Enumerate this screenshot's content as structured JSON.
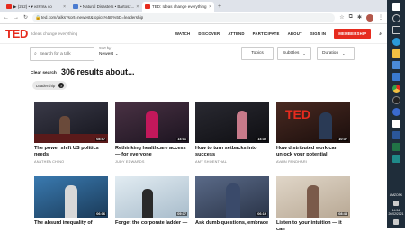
{
  "browser": {
    "tabs": [
      {
        "label": "▶ (262) • ♥ ᴋᴇᴘᴛʀᴀ ᴄᴏ",
        "color": "#e62b1e",
        "active": false
      },
      {
        "label": "• Natural Disasters • Bartosz...",
        "color": "#4a7bd0",
        "active": false
      },
      {
        "label": "TED: Ideas change everything",
        "color": "#e62b1e",
        "active": true
      }
    ],
    "url": "ted.com/talks?sort=newest&topics%5B%5D=leadership"
  },
  "header": {
    "logo": "TED",
    "tagline": "Ideas change everything",
    "nav": [
      "WATCH",
      "DISCOVER",
      "ATTEND",
      "PARTICIPATE",
      "ABOUT",
      "SIGN IN"
    ],
    "membership": "MEMBERSHIP"
  },
  "filters": {
    "search_placeholder": "Search for a talk",
    "sort_label": "Sort by",
    "sort_value": "Newest",
    "topics": "Topics",
    "subtitles": "Subtitles",
    "duration": "Duration"
  },
  "results": {
    "clear": "Clear search",
    "count_text": "306 results about...",
    "chip": "Leadership"
  },
  "talks": [
    {
      "title": "The power shift US politics needs",
      "speaker": "ANATHEA CHINO",
      "duration": "08:57",
      "bg": "#2a2a35"
    },
    {
      "title": "Rethinking healthcare access — for everyone",
      "speaker": "JUDY EDWARDS",
      "duration": "14:01",
      "bg": "#3b2a36"
    },
    {
      "title": "How to turn setbacks into success",
      "speaker": "AMY SHOENTHAL",
      "duration": "14:30",
      "bg": "#1c1c24"
    },
    {
      "title": "How distributed work can unlock your potential",
      "speaker": "AVAIN PANDHARI",
      "duration": "10:37",
      "bg": "#3a2420"
    },
    {
      "title": "The absurd inequality of",
      "speaker": "",
      "duration": "06:06",
      "bg": "#2c5f8a"
    },
    {
      "title": "Forget the corporate ladder —",
      "speaker": "",
      "duration": "09:37",
      "bg": "#c8d8e4"
    },
    {
      "title": "Ask dumb questions, embrace",
      "speaker": "",
      "duration": "06:19",
      "bg": "#4a5a78"
    },
    {
      "title": "Listen to your intuition — it can",
      "speaker": "",
      "duration": "08:48",
      "bg": "#d4c8b8"
    }
  ],
  "taskbar": {
    "lang": "AMZOSK",
    "time": "14:54",
    "date": "26/02/2021"
  }
}
